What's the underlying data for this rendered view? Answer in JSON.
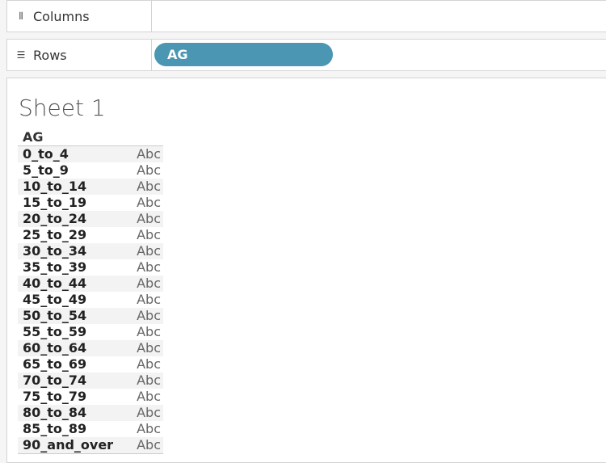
{
  "shelves": {
    "columns": {
      "label": "Columns",
      "icon": "columns-icon",
      "pills": []
    },
    "rows": {
      "label": "Rows",
      "icon": "rows-icon",
      "pills": [
        "AG"
      ]
    }
  },
  "pill_color": "#4a96b3",
  "sheet": {
    "title": "Sheet 1",
    "header": "AG",
    "rows": [
      {
        "label": "0_to_4",
        "value": "Abc"
      },
      {
        "label": "5_to_9",
        "value": "Abc"
      },
      {
        "label": "10_to_14",
        "value": "Abc"
      },
      {
        "label": "15_to_19",
        "value": "Abc"
      },
      {
        "label": "20_to_24",
        "value": "Abc"
      },
      {
        "label": "25_to_29",
        "value": "Abc"
      },
      {
        "label": "30_to_34",
        "value": "Abc"
      },
      {
        "label": "35_to_39",
        "value": "Abc"
      },
      {
        "label": "40_to_44",
        "value": "Abc"
      },
      {
        "label": "45_to_49",
        "value": "Abc"
      },
      {
        "label": "50_to_54",
        "value": "Abc"
      },
      {
        "label": "55_to_59",
        "value": "Abc"
      },
      {
        "label": "60_to_64",
        "value": "Abc"
      },
      {
        "label": "65_to_69",
        "value": "Abc"
      },
      {
        "label": "70_to_74",
        "value": "Abc"
      },
      {
        "label": "75_to_79",
        "value": "Abc"
      },
      {
        "label": "80_to_84",
        "value": "Abc"
      },
      {
        "label": "85_to_89",
        "value": "Abc"
      },
      {
        "label": "90_and_over",
        "value": "Abc"
      }
    ]
  }
}
